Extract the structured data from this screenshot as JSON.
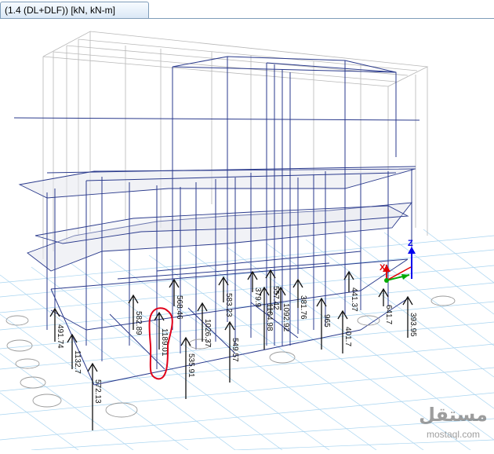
{
  "tab": {
    "title": "(1.4 (DL+DLF))  [kN, kN-m]"
  },
  "axes": {
    "x": "X",
    "z": "Z"
  },
  "reactions": [
    "491.74",
    "1132.7",
    "572.13",
    "582.89",
    "1189.01",
    "535.91",
    "568.46",
    "1026.37",
    "549.57",
    "583.23",
    "379.9",
    "1104.98",
    "557.42",
    "1092.92",
    "381.76",
    "965",
    "401.7",
    "441.37",
    "641.7",
    "393.95"
  ],
  "watermark": {
    "arabic": "مستقل",
    "latin": "mostaql.com"
  },
  "colors": {
    "frame": "#2a3a8c",
    "grid": "#9fd0ee",
    "ghost": "#b4b4b4",
    "highlight": "#e0001a",
    "axisX": "#e00000",
    "axisY": "#00aa00",
    "axisZ": "#0000ee"
  }
}
